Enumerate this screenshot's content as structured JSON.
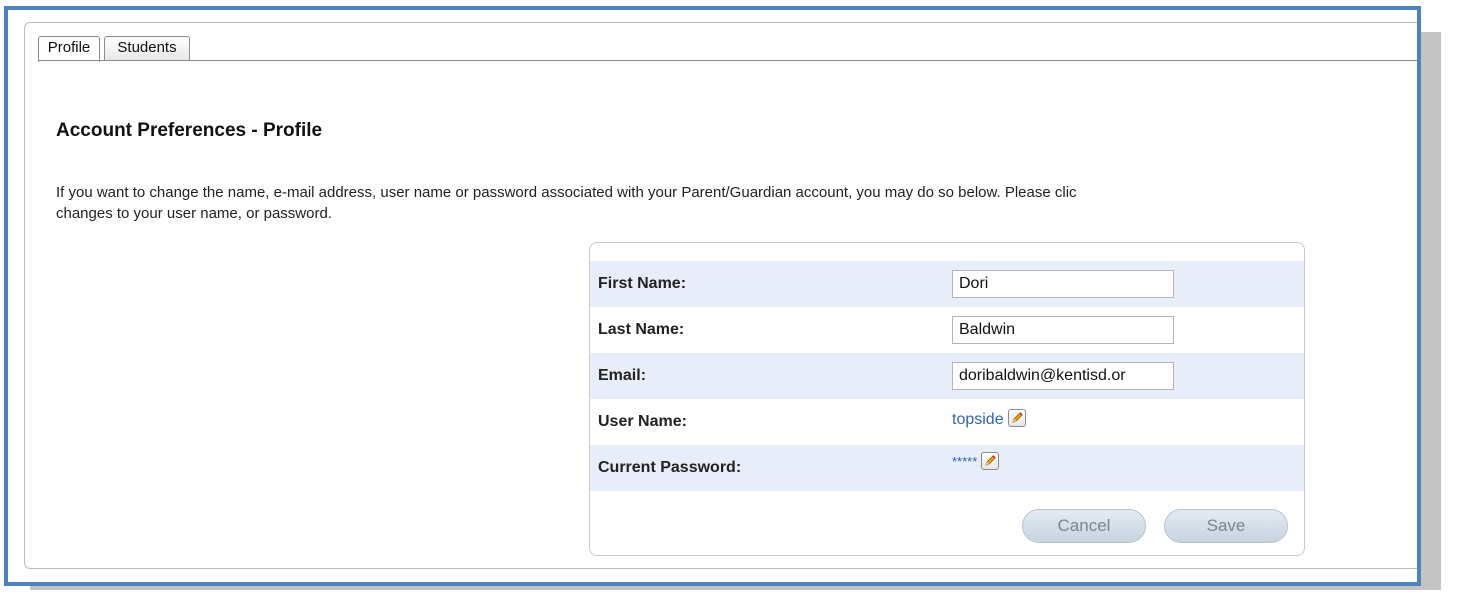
{
  "tabs": [
    {
      "label": "Profile",
      "active": true
    },
    {
      "label": "Students",
      "active": false
    }
  ],
  "page": {
    "title": "Account Preferences - Profile",
    "description_line1": "If you want to change the name, e-mail address, user name or password associated with your Parent/Guardian account, you may do so below. Please clic",
    "description_line2": "changes to your user name, or password."
  },
  "form": {
    "first_name_label": "First Name:",
    "first_name_value": "Dori",
    "last_name_label": "Last Name:",
    "last_name_value": "Baldwin",
    "email_label": "Email:",
    "email_value": "doribaldwin@kentisd.or",
    "username_label": "User Name:",
    "username_value": "topside",
    "password_label": "Current Password:",
    "password_value": "*****"
  },
  "buttons": {
    "cancel_label": "Cancel",
    "save_label": "Save"
  },
  "icons": {
    "edit": "pencil-edit-icon"
  },
  "colors": {
    "frame_border": "#4f81bd",
    "row_alt": "#e8eef9",
    "link": "#2f64b6"
  }
}
